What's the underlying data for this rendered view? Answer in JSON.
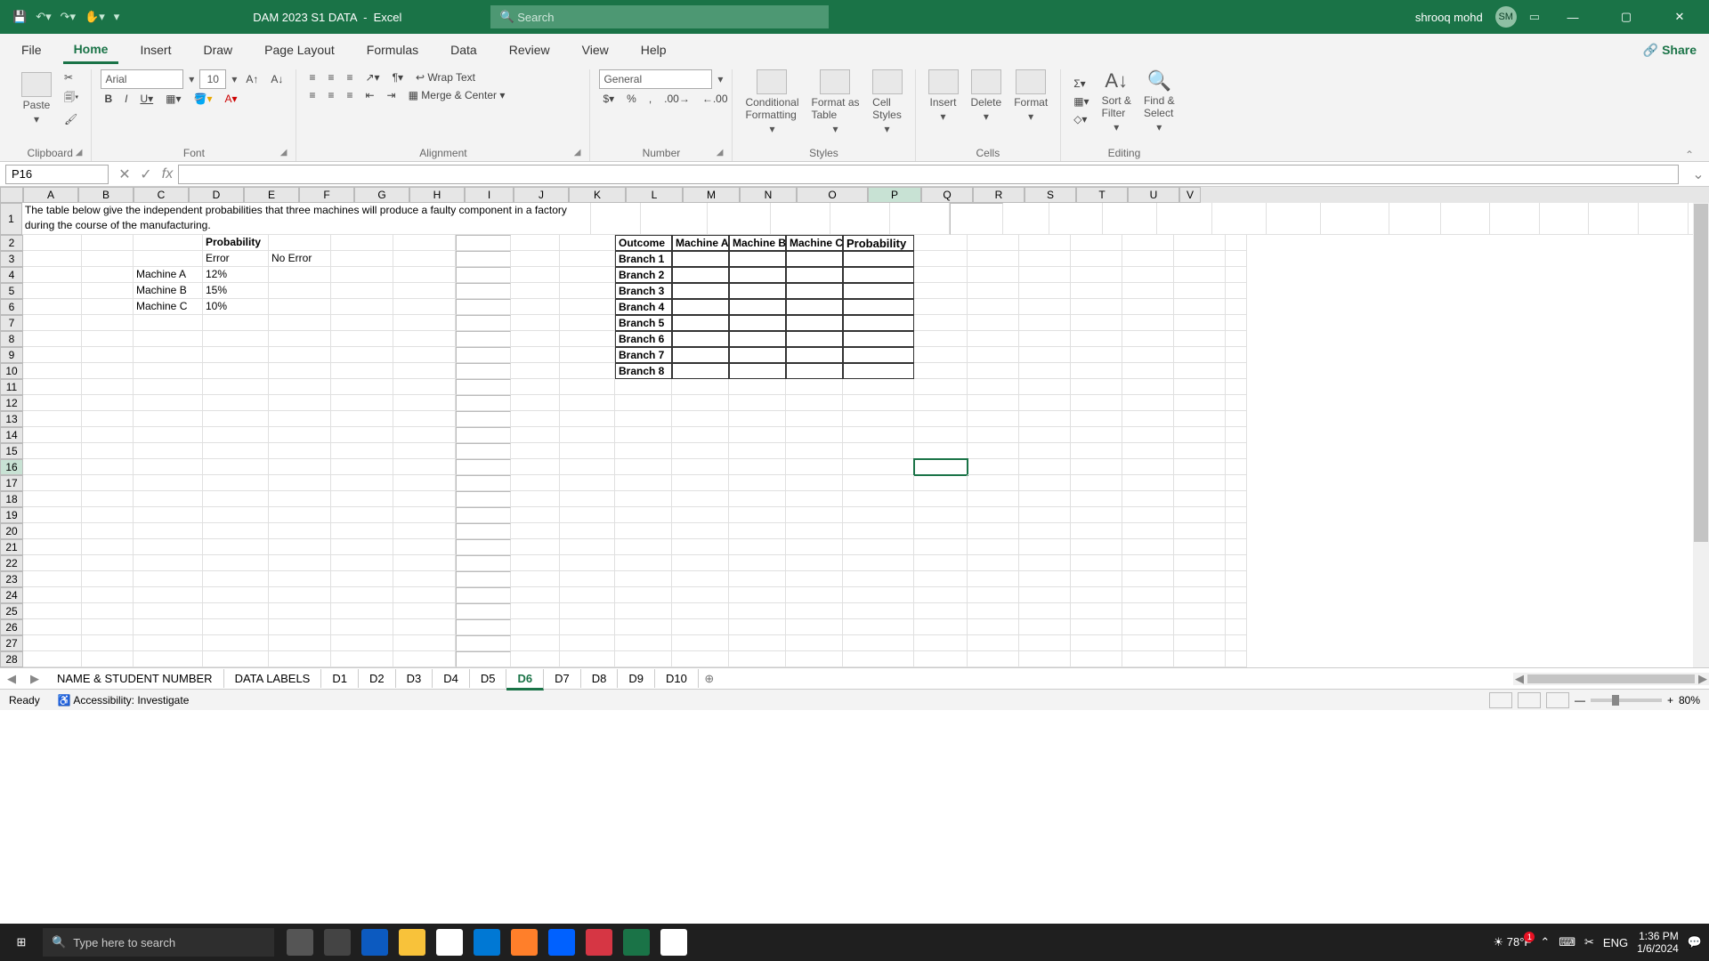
{
  "title": {
    "filename": "DAM 2023 S1 DATA",
    "app": "Excel"
  },
  "search_placeholder": "Search",
  "user": {
    "name": "shrooq mohd",
    "initials": "SM"
  },
  "ribbon_tabs": [
    "File",
    "Home",
    "Insert",
    "Draw",
    "Page Layout",
    "Formulas",
    "Data",
    "Review",
    "View",
    "Help"
  ],
  "active_ribbon_tab": "Home",
  "share_label": "Share",
  "ribbon": {
    "clipboard": {
      "paste": "Paste",
      "group": "Clipboard"
    },
    "font": {
      "name": "Arial",
      "size": "10",
      "group": "Font"
    },
    "alignment": {
      "wrap": "Wrap Text",
      "merge": "Merge & Center",
      "group": "Alignment"
    },
    "number": {
      "format": "General",
      "group": "Number"
    },
    "styles": {
      "cond": "Conditional\nFormatting",
      "fat": "Format as\nTable",
      "cell": "Cell\nStyles",
      "group": "Styles"
    },
    "cells": {
      "insert": "Insert",
      "delete": "Delete",
      "format": "Format",
      "group": "Cells"
    },
    "editing": {
      "sort": "Sort &\nFilter",
      "find": "Find &\nSelect",
      "group": "Editing"
    }
  },
  "namebox": "P16",
  "columns": [
    "A",
    "B",
    "C",
    "D",
    "E",
    "F",
    "G",
    "H",
    "I",
    "J",
    "K",
    "L",
    "M",
    "N",
    "O",
    "P",
    "Q",
    "R",
    "S",
    "T",
    "U",
    "V"
  ],
  "rows": 28,
  "content": {
    "A1": "The table below give the independent probabilities that three machines will produce a faulty component in a factory during the course of the manufacturing.",
    "D2": "Probability",
    "D3": "Error",
    "E3": "No Error",
    "C4": "Machine A",
    "D4": "12%",
    "C5": "Machine B",
    "D5": "15%",
    "C6": "Machine C",
    "D6": "10%"
  },
  "outcome_table": {
    "headers": [
      "Outcome",
      "Machine A",
      "Machine B",
      "Machine C",
      "Probability"
    ],
    "rows": [
      "Branch 1",
      "Branch 2",
      "Branch 3",
      "Branch 4",
      "Branch 5",
      "Branch 6",
      "Branch 7",
      "Branch 8"
    ]
  },
  "sheet_tabs": [
    "NAME & STUDENT NUMBER",
    "DATA LABELS",
    "D1",
    "D2",
    "D3",
    "D4",
    "D5",
    "D6",
    "D7",
    "D8",
    "D9",
    "D10"
  ],
  "active_sheet": "D6",
  "status": {
    "ready": "Ready",
    "acc": "Accessibility: Investigate",
    "zoom": "80%"
  },
  "taskbar": {
    "search": "Type here to search",
    "temp": "78°F",
    "lang": "ENG",
    "time": "1:36 PM",
    "date": "1/6/2024"
  }
}
